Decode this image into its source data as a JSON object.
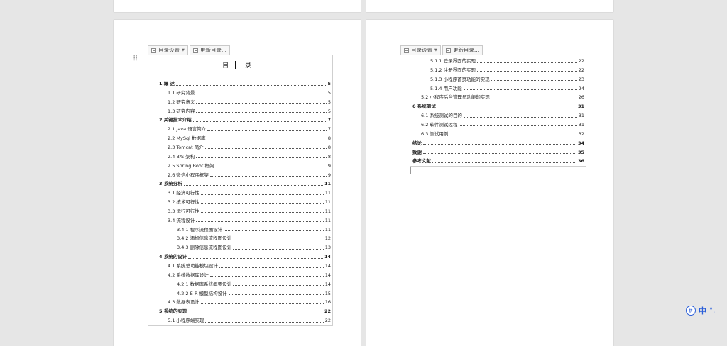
{
  "toolbar": {
    "toc_settings_label": "目录设置",
    "update_toc_label": "更新目录..."
  },
  "toc_title": "目    录",
  "left_page_entries": [
    {
      "label": "1   概    述",
      "page": "5",
      "level": 1
    },
    {
      "label": "1.1 研究背景",
      "page": "5",
      "level": 2
    },
    {
      "label": "1.2 研究意义",
      "page": "5",
      "level": 2
    },
    {
      "label": "1.3 研究内容",
      "page": "5",
      "level": 2
    },
    {
      "label": "2   关键技术介绍",
      "page": "7",
      "level": 1
    },
    {
      "label": "2.1 Java 语言简介",
      "page": "7",
      "level": 2
    },
    {
      "label": "2.2 MySql 数据库",
      "page": "8",
      "level": 2
    },
    {
      "label": "2.3 Tomcat 简介",
      "page": "8",
      "level": 2
    },
    {
      "label": "2.4 B/S 架构",
      "page": "8",
      "level": 2
    },
    {
      "label": "2.5 Spring Boot 框架",
      "page": "9",
      "level": 2
    },
    {
      "label": "2.6 微信小程序框架",
      "page": "9",
      "level": 2
    },
    {
      "label": "3   系统分析",
      "page": "11",
      "level": 1
    },
    {
      "label": "3.1 经济可行性",
      "page": "11",
      "level": 2
    },
    {
      "label": "3.2 技术可行性",
      "page": "11",
      "level": 2
    },
    {
      "label": "3.3 运行可行性",
      "page": "11",
      "level": 2
    },
    {
      "label": "3.4 流程设计",
      "page": "11",
      "level": 2
    },
    {
      "label": "3.4.1 程序流程图设计",
      "page": "11",
      "level": 3
    },
    {
      "label": "3.4.2 添加信息流程图设计",
      "page": "12",
      "level": 3
    },
    {
      "label": "3.4.3 删除信息流程图设计",
      "page": "13",
      "level": 3
    },
    {
      "label": "4   系统的设计",
      "page": "14",
      "level": 1
    },
    {
      "label": "4.1 系统总功能模块设计",
      "page": "14",
      "level": 2
    },
    {
      "label": "4.2 系统数据库设计",
      "page": "14",
      "level": 2
    },
    {
      "label": "4.2.1 数据库系统概要设计",
      "page": "14",
      "level": 3
    },
    {
      "label": "4.2.2 E-R 模型结构设计",
      "page": "15",
      "level": 3
    },
    {
      "label": "4.3 数据表设计",
      "page": "16",
      "level": 2
    },
    {
      "label": "5   系统的实现",
      "page": "22",
      "level": 1
    },
    {
      "label": "5.1 小程序端实现",
      "page": "22",
      "level": 2
    }
  ],
  "right_page_entries": [
    {
      "label": "5.1.1 登录界面的实现",
      "page": "22",
      "level": 3
    },
    {
      "label": "5.1.2 注册界面的实现",
      "page": "22",
      "level": 3
    },
    {
      "label": "5.1.3 小程序首页功能的实现",
      "page": "23",
      "level": 3
    },
    {
      "label": "5.1.4 用户功能",
      "page": "24",
      "level": 3
    },
    {
      "label": "5.2 小程序后台管理员功能的实现",
      "page": "26",
      "level": 2
    },
    {
      "label": "6 系统测试",
      "page": "31",
      "level": 1
    },
    {
      "label": "6.1 系统测试的目的",
      "page": "31",
      "level": 2
    },
    {
      "label": "6.2 软件测试过程",
      "page": "31",
      "level": 2
    },
    {
      "label": "6.3 测试用例",
      "page": "32",
      "level": 2
    },
    {
      "label": "结论",
      "page": "34",
      "level": 1
    },
    {
      "label": "致谢",
      "page": "35",
      "level": 1
    },
    {
      "label": "参考文献",
      "page": "36",
      "level": 1
    }
  ],
  "ime": {
    "logo_text": "拼",
    "mode_text": "中",
    "extra": "°,"
  }
}
